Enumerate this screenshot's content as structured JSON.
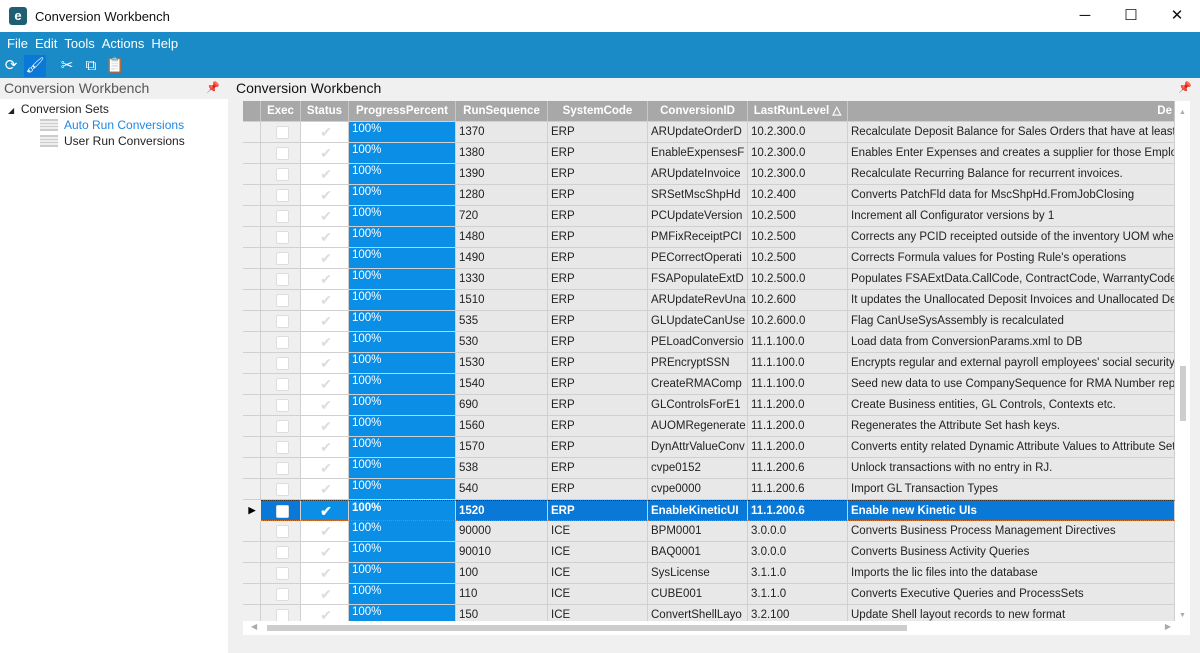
{
  "window": {
    "title": "Conversion Workbench",
    "minimize": "─",
    "maximize": "☐",
    "close": "✕",
    "app_icon": "e"
  },
  "menu": [
    "File",
    "Edit",
    "Tools",
    "Actions",
    "Help"
  ],
  "toolbar": [
    {
      "icon": "refresh-icon",
      "glyph": "⟳"
    },
    {
      "icon": "clear-broom-icon",
      "glyph": "🖌"
    },
    {
      "icon": "cut-icon",
      "glyph": "✂"
    },
    {
      "icon": "copy-icon",
      "glyph": "⧉"
    },
    {
      "icon": "paste-icon",
      "glyph": "📋"
    }
  ],
  "left_panel": {
    "title": "Conversion Workbench",
    "pin": "📌",
    "tree": {
      "root": "Conversion Sets",
      "items": [
        "Auto Run Conversions",
        "User Run Conversions"
      ],
      "selected": "Auto Run Conversions"
    }
  },
  "main": {
    "title": "Conversion Workbench",
    "pin": "📌"
  },
  "grid": {
    "columns": [
      "Exec",
      "Status",
      "ProgressPercent",
      "RunSequence",
      "SystemCode",
      "ConversionID",
      "LastRunLevel △",
      "De"
    ],
    "selected_index": 18,
    "rows": [
      [
        "100%",
        "1370",
        "ERP",
        "ARUpdateOrderD",
        "10.2.300.0",
        "Recalculate Deposit Balance for Sales Orders that have at least"
      ],
      [
        "100%",
        "1380",
        "ERP",
        "EnableExpensesF",
        "10.2.300.0",
        "Enables Enter Expenses and creates a supplier for those Emplo"
      ],
      [
        "100%",
        "1390",
        "ERP",
        "ARUpdateInvoice",
        "10.2.300.0",
        "Recalculate Recurring Balance for recurrent invoices."
      ],
      [
        "100%",
        "1280",
        "ERP",
        "SRSetMscShpHd",
        "10.2.400",
        "Converts PatchFld data for MscShpHd.FromJobClosing"
      ],
      [
        "100%",
        "720",
        "ERP",
        "PCUpdateVersion",
        "10.2.500",
        "Increment all Configurator versions by 1"
      ],
      [
        "100%",
        "1480",
        "ERP",
        "PMFixReceiptPCI",
        "10.2.500",
        "Corrects any PCID receipted outside of the inventory UOM whe"
      ],
      [
        "100%",
        "1490",
        "ERP",
        "PECorrectOperati",
        "10.2.500",
        "Corrects Formula values for Posting Rule's operations"
      ],
      [
        "100%",
        "1330",
        "ERP",
        "FSAPopulateExtD",
        "10.2.500.0",
        "Populates FSAExtData.CallCode, ContractCode, WarrantyCode"
      ],
      [
        "100%",
        "1510",
        "ERP",
        "ARUpdateRevUna",
        "10.2.600",
        "It updates the Unallocated Deposit Invoices and Unallocated De"
      ],
      [
        "100%",
        "535",
        "ERP",
        "GLUpdateCanUse",
        "10.2.600.0",
        "Flag CanUseSysAssembly is recalculated"
      ],
      [
        "100%",
        "530",
        "ERP",
        "PELoadConversio",
        "11.1.100.0",
        "Load data from ConversionParams.xml to DB"
      ],
      [
        "100%",
        "1530",
        "ERP",
        "PREncryptSSN",
        "11.1.100.0",
        "Encrypts regular and external payroll employees' social security"
      ],
      [
        "100%",
        "1540",
        "ERP",
        "CreateRMAComp",
        "11.1.100.0",
        "Seed new data to use CompanySequence for RMA Number repla"
      ],
      [
        "100%",
        "690",
        "ERP",
        "GLControlsForE1",
        "11.1.200.0",
        "Create Business entities, GL Controls, Contexts etc."
      ],
      [
        "100%",
        "1560",
        "ERP",
        "AUOMRegenerate",
        "11.1.200.0",
        "Regenerates the Attribute Set hash keys."
      ],
      [
        "100%",
        "1570",
        "ERP",
        "DynAttrValueConv",
        "11.1.200.0",
        "Converts entity related Dynamic Attribute Values to Attribute Sets"
      ],
      [
        "100%",
        "538",
        "ERP",
        "cvpe0152",
        "11.1.200.6",
        "Unlock transactions with no entry in RJ."
      ],
      [
        "100%",
        "540",
        "ERP",
        "cvpe0000",
        "11.1.200.6",
        "Import GL Transaction Types"
      ],
      [
        "100%",
        "1520",
        "ERP",
        "EnableKineticUI",
        "11.1.200.6",
        "Enable new Kinetic UIs"
      ],
      [
        "100%",
        "90000",
        "ICE",
        "BPM0001",
        "3.0.0.0",
        "Converts Business Process Management Directives"
      ],
      [
        "100%",
        "90010",
        "ICE",
        "BAQ0001",
        "3.0.0.0",
        "Converts Business Activity Queries"
      ],
      [
        "100%",
        "100",
        "ICE",
        "SysLicense",
        "3.1.1.0",
        "Imports the lic files into the database"
      ],
      [
        "100%",
        "110",
        "ICE",
        "CUBE001",
        "3.1.1.0",
        "Converts Executive Queries and ProcessSets"
      ],
      [
        "100%",
        "150",
        "ICE",
        "ConvertShellLayo",
        "3.2.100",
        "Update Shell layout records to new format"
      ]
    ]
  },
  "colors": {
    "accent": "#1a8bc6",
    "progress": "#0a8ee6",
    "selection": "#0a78d6",
    "link": "#1e88e5"
  }
}
